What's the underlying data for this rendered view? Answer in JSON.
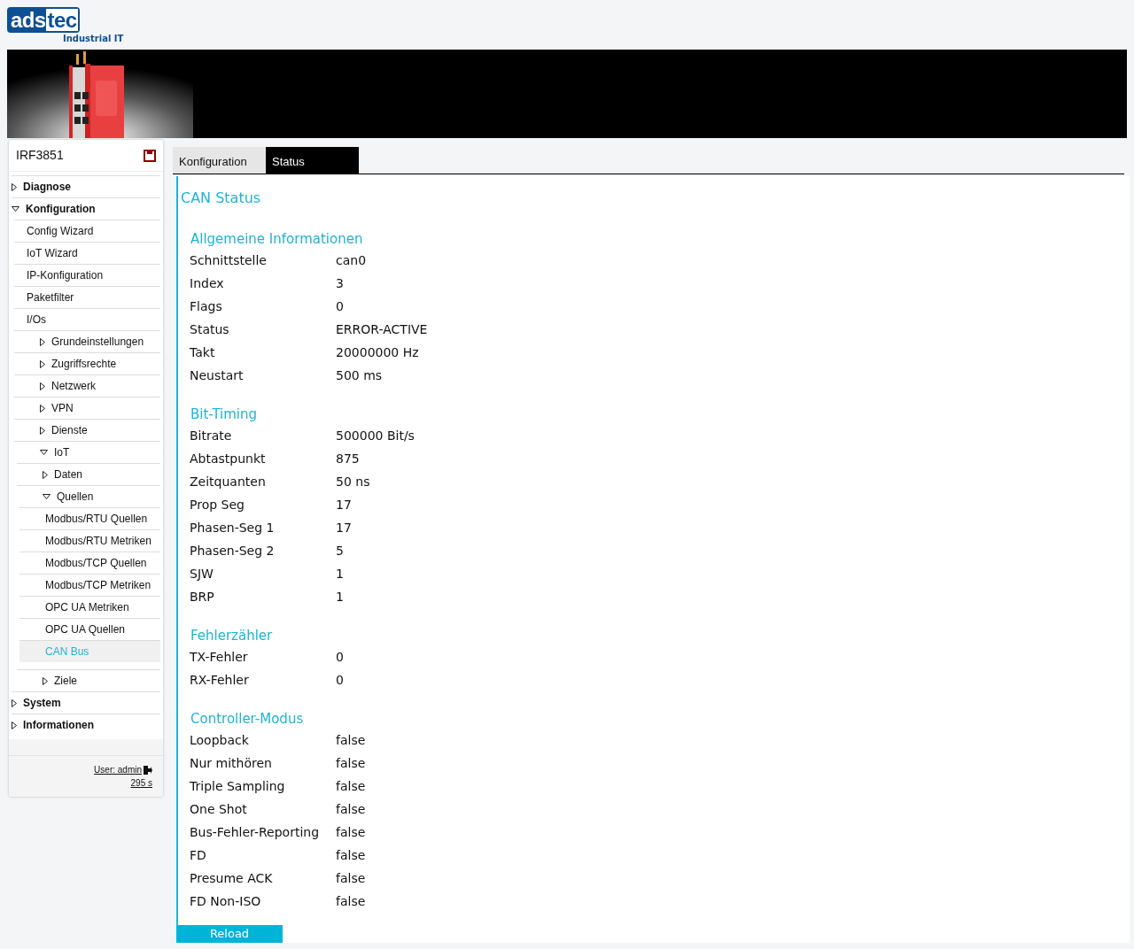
{
  "logo": {
    "part_1": "ads",
    "part_2": "tec",
    "tagline": "Industrial IT"
  },
  "sidebar": {
    "device_name": "IRF3851",
    "items": [
      {
        "label": "Diagnose",
        "expanded": false,
        "selected": false
      },
      {
        "label": "Konfiguration",
        "expanded": true,
        "selected": false,
        "children": [
          {
            "label": "Config Wizard",
            "selected": false
          },
          {
            "label": "IoT Wizard",
            "selected": false
          },
          {
            "label": "IP-Konfiguration",
            "selected": false
          },
          {
            "label": "Paketfilter",
            "selected": false
          },
          {
            "label": "I/Os",
            "selected": false,
            "children": [
              {
                "label": "Grundeinstellungen",
                "expanded": false,
                "selected": false
              },
              {
                "label": "Zugriffsrechte",
                "expanded": false,
                "selected": false
              },
              {
                "label": "Netzwerk",
                "expanded": false,
                "selected": false
              },
              {
                "label": "VPN",
                "expanded": false,
                "selected": false
              },
              {
                "label": "Dienste",
                "expanded": false,
                "selected": false
              },
              {
                "label": "IoT",
                "expanded": true,
                "selected": false,
                "children": [
                  {
                    "label": "Daten",
                    "expanded": false,
                    "selected": false
                  },
                  {
                    "label": "Quellen",
                    "expanded": true,
                    "selected": false,
                    "children": [
                      {
                        "label": "Modbus/RTU Quellen",
                        "selected": false
                      },
                      {
                        "label": "Modbus/RTU Metriken",
                        "selected": false
                      },
                      {
                        "label": "Modbus/TCP Quellen",
                        "selected": false
                      },
                      {
                        "label": "Modbus/TCP Metriken",
                        "selected": false
                      },
                      {
                        "label": "OPC UA Metriken",
                        "selected": false
                      },
                      {
                        "label": "OPC UA Quellen",
                        "selected": false
                      },
                      {
                        "label": "CAN Bus",
                        "selected": true
                      }
                    ]
                  },
                  {
                    "label": "Ziele",
                    "expanded": false,
                    "selected": false
                  }
                ]
              }
            ]
          }
        ]
      },
      {
        "label": "System",
        "expanded": false,
        "selected": false
      },
      {
        "label": "Informationen",
        "expanded": false,
        "selected": false
      }
    ],
    "user_link": "User: admin",
    "session_timer": "295 s"
  },
  "tabs": [
    {
      "label": "Konfiguration",
      "selected": false
    },
    {
      "label": "Status",
      "selected": true
    }
  ],
  "panel": {
    "title": "CAN Status",
    "sections": [
      {
        "title": "Allgemeine Informationen",
        "rows": [
          [
            "Schnittstelle",
            "can0"
          ],
          [
            "Index",
            "3"
          ],
          [
            "Flags",
            "0"
          ],
          [
            "Status",
            "ERROR-ACTIVE"
          ],
          [
            "Takt",
            "20000000 Hz"
          ],
          [
            "Neustart",
            "500 ms"
          ]
        ]
      },
      {
        "title": "Bit-Timing",
        "rows": [
          [
            "Bitrate",
            "500000 Bit/s"
          ],
          [
            "Abtastpunkt",
            "875"
          ],
          [
            "Zeitquanten",
            "50 ns"
          ],
          [
            "Prop Seg",
            "17"
          ],
          [
            "Phasen-Seg 1",
            "17"
          ],
          [
            "Phasen-Seg 2",
            "5"
          ],
          [
            "SJW",
            "1"
          ],
          [
            "BRP",
            "1"
          ]
        ]
      },
      {
        "title": "Fehlerzähler",
        "rows": [
          [
            "TX-Fehler",
            "0"
          ],
          [
            "RX-Fehler",
            "0"
          ]
        ]
      },
      {
        "title": "Controller-Modus",
        "rows": [
          [
            "Loopback",
            "false"
          ],
          [
            "Nur mithören",
            "false"
          ],
          [
            "Triple Sampling",
            "false"
          ],
          [
            "One Shot",
            "false"
          ],
          [
            "Bus-Fehler-Reporting",
            "false"
          ],
          [
            "FD",
            "false"
          ],
          [
            "Presume ACK",
            "false"
          ],
          [
            "FD Non-ISO",
            "false"
          ]
        ]
      }
    ],
    "reload_button": "Reload"
  }
}
